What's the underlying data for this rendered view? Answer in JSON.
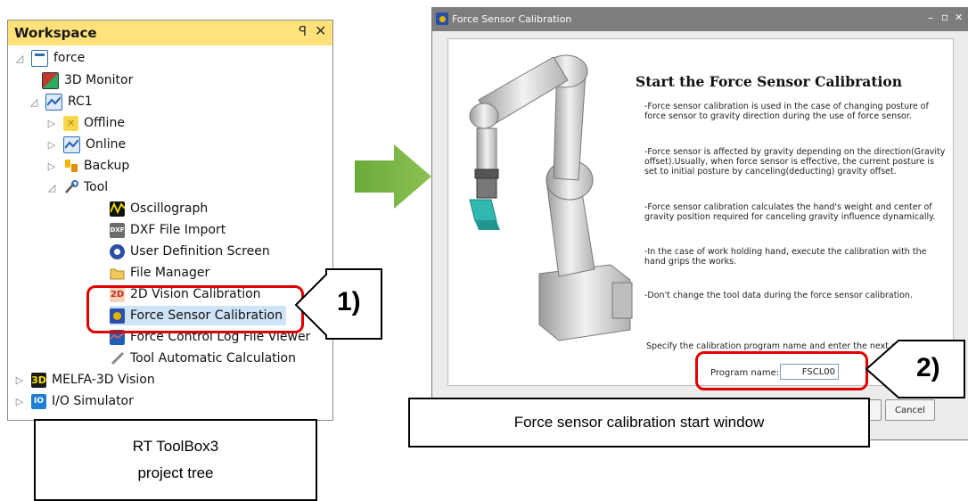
{
  "workspace": {
    "title": "Workspace",
    "pin_glyph": "ꟼ",
    "close_glyph": "✕",
    "tree": [
      {
        "label": "force",
        "icon": "project-icon"
      },
      {
        "label": "3D Monitor",
        "icon": "monitor-3d-icon"
      },
      {
        "label": "RC1",
        "icon": "robot-controller-icon"
      },
      {
        "label": "Offline",
        "icon": "offline-icon"
      },
      {
        "label": "Online",
        "icon": "online-icon"
      },
      {
        "label": "Backup",
        "icon": "backup-icon"
      },
      {
        "label": "Tool",
        "icon": "tool-icon"
      },
      {
        "label": "Oscillograph",
        "icon": "oscillograph-icon"
      },
      {
        "label": "DXF File Import",
        "icon": "dxf-icon"
      },
      {
        "label": "User Definition Screen",
        "icon": "user-definition-icon"
      },
      {
        "label": "File Manager",
        "icon": "folder-icon"
      },
      {
        "label": "2D Vision Calibration",
        "icon": "vision-2d-icon"
      },
      {
        "label": "Force Sensor Calibration",
        "icon": "force-sensor-icon"
      },
      {
        "label": "Force Control Log File Viewer",
        "icon": "log-viewer-icon"
      },
      {
        "label": "Tool Automatic Calculation",
        "icon": "tool-calc-icon"
      },
      {
        "label": "MELFA-3D Vision",
        "icon": "melfa-3d-icon"
      },
      {
        "label": "I/O Simulator",
        "icon": "io-simulator-icon"
      }
    ]
  },
  "callouts": {
    "one": "1)",
    "two": "2)"
  },
  "captions": {
    "tree_line1": "RT ToolBox3",
    "tree_line2": "project tree",
    "window": "Force sensor calibration start window"
  },
  "dialog": {
    "title": "Force Sensor Calibration",
    "min_glyph": "–",
    "max_glyph": "▫",
    "close_glyph": "✕",
    "heading": "Start the Force Sensor Calibration",
    "paragraphs": [
      "-Force sensor calibration is used in the case of changing posture of force sensor to gravity direction during the use of force sensor.",
      "-Force sensor is affected by gravity depending on the direction(Gravity offset).Usually, when force sensor is effective, the current posture is set to initial posture by canceling(deducting) gravity offset.",
      "-Force sensor calibration calculates the hand's weight and center of gravity position required for canceling gravity influence dynamically.",
      "-In the case of work holding hand, execute the calibration with the hand grips the works.",
      "-Don't change the tool data during the force sensor calibration."
    ],
    "specify": "Specify the calibration program name and enter the next page.",
    "program_label": "Program name:",
    "program_value": "FSCL00",
    "next_label": ">",
    "cancel_label": "Cancel"
  },
  "colors": {
    "workspace_header": "#ffe27a",
    "callout_red": "#e00000",
    "arrow_green": "#7cb342",
    "selection": "#cfe3f7"
  }
}
